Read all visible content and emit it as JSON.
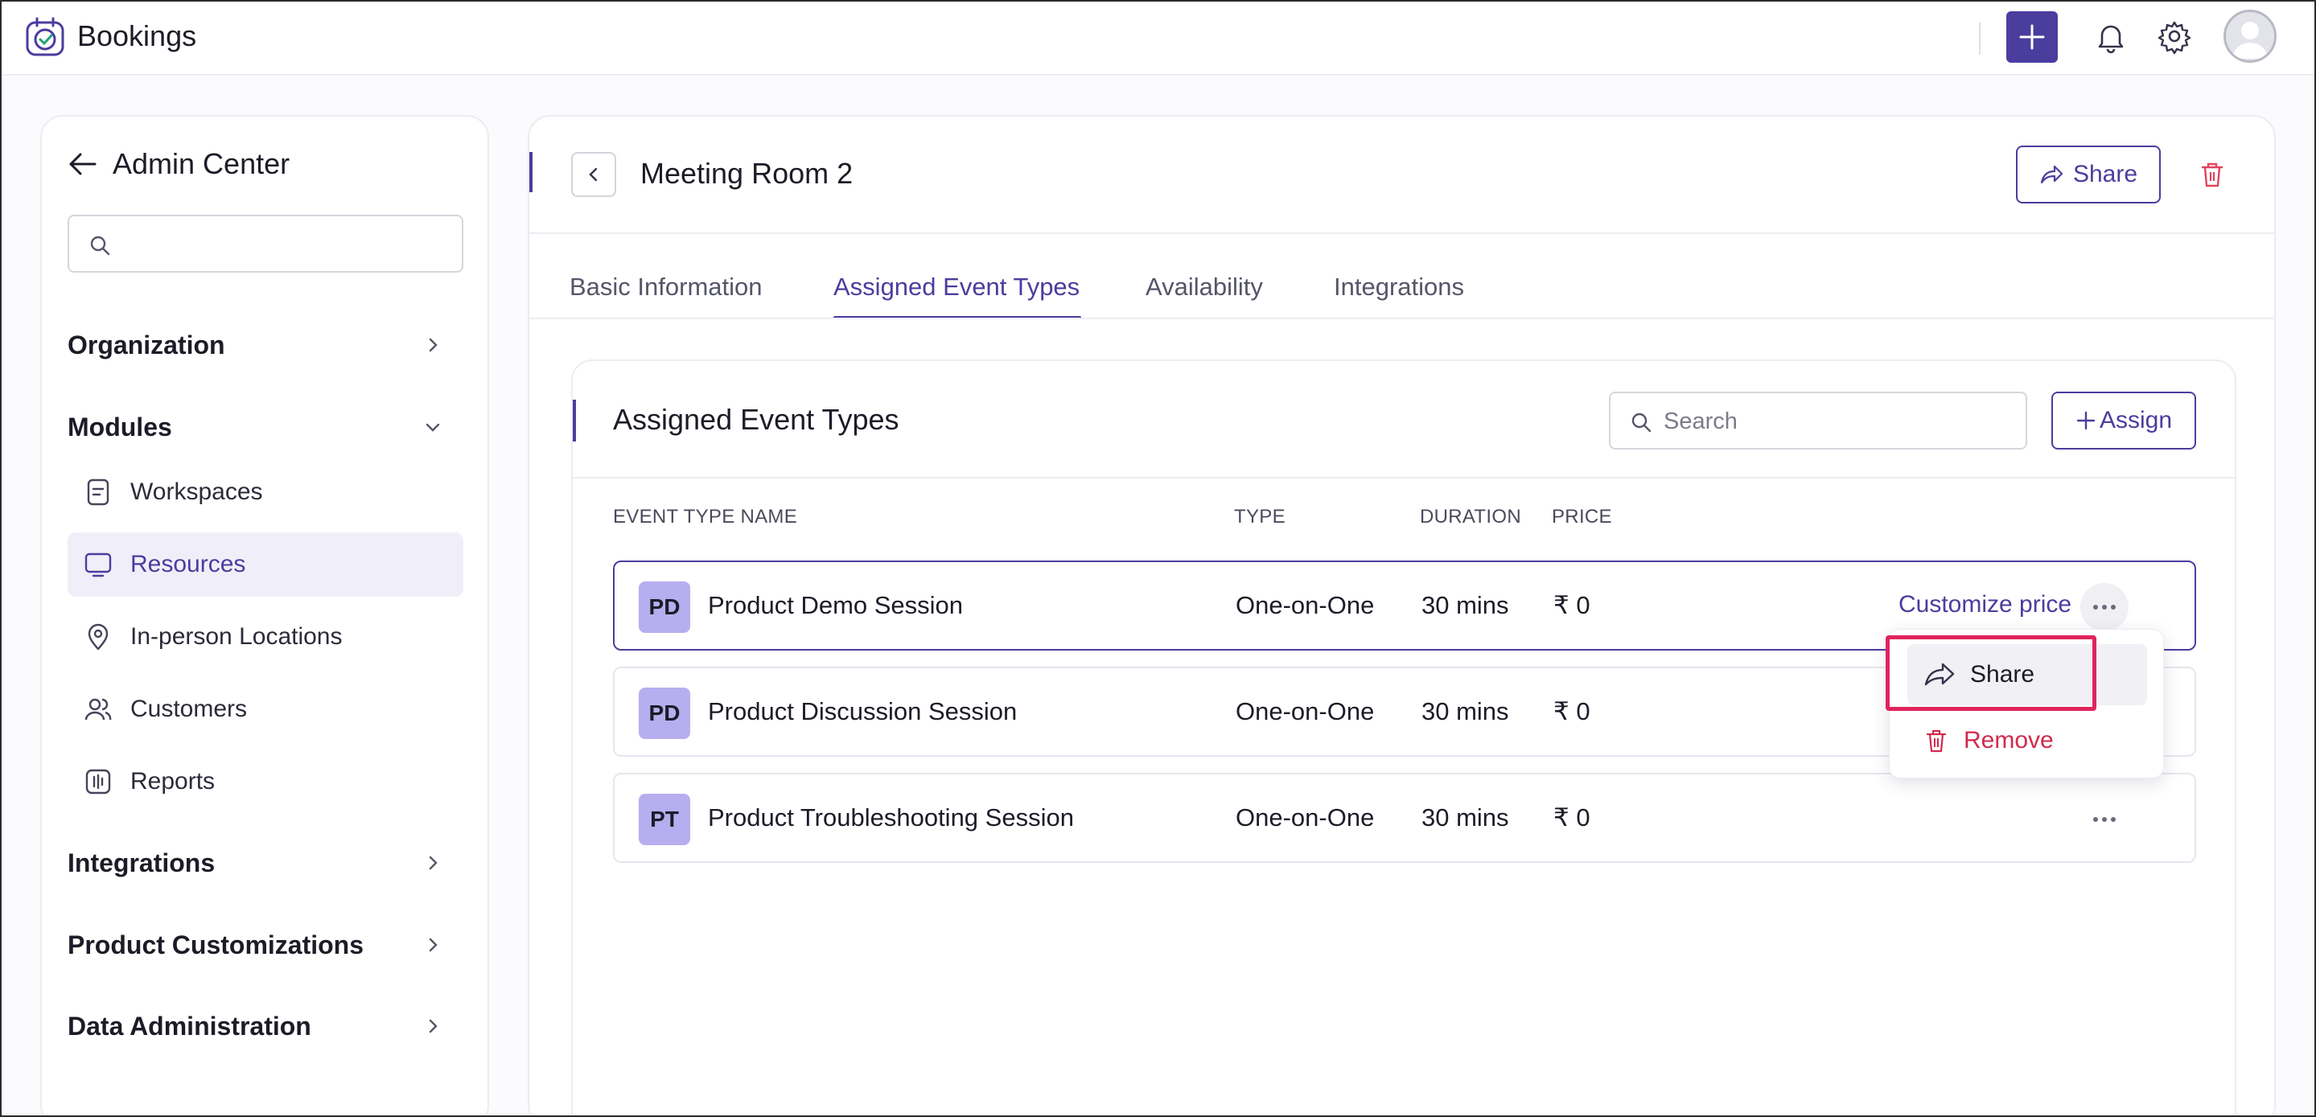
{
  "app": {
    "title": "Bookings"
  },
  "sidebar": {
    "back_label": "Admin Center",
    "search_placeholder": "",
    "sections": {
      "organization": "Organization",
      "modules": "Modules",
      "integrations": "Integrations",
      "product_customizations": "Product Customizations",
      "data_administration": "Data Administration"
    },
    "modules_items": [
      {
        "label": "Workspaces",
        "icon": "workspace-icon"
      },
      {
        "label": "Resources",
        "icon": "monitor-icon",
        "active": true
      },
      {
        "label": "In-person Locations",
        "icon": "location-pin-icon"
      },
      {
        "label": "Customers",
        "icon": "users-icon"
      },
      {
        "label": "Reports",
        "icon": "reports-icon"
      }
    ]
  },
  "header": {
    "title": "Meeting Room 2",
    "share_label": "Share"
  },
  "tabs": [
    {
      "label": "Basic Information"
    },
    {
      "label": "Assigned Event Types",
      "active": true
    },
    {
      "label": "Availability"
    },
    {
      "label": "Integrations"
    }
  ],
  "section": {
    "title": "Assigned Event Types",
    "search_placeholder": "Search",
    "assign_label": "Assign"
  },
  "table": {
    "columns": [
      "EVENT TYPE NAME",
      "TYPE",
      "DURATION",
      "PRICE"
    ],
    "rows": [
      {
        "initials": "PD",
        "name": "Product Demo Session",
        "type": "One-on-One",
        "duration": "30 mins",
        "price": "₹ 0",
        "action": "Customize price"
      },
      {
        "initials": "PD",
        "name": "Product Discussion Session",
        "type": "One-on-One",
        "duration": "30 mins",
        "price": "₹ 0"
      },
      {
        "initials": "PT",
        "name": "Product Troubleshooting Session",
        "type": "One-on-One",
        "duration": "30 mins",
        "price": "₹ 0"
      }
    ]
  },
  "menu": {
    "share": "Share",
    "remove": "Remove"
  },
  "colors": {
    "accent": "#4b3d9e",
    "danger": "#d12a4c",
    "badge": "#b7aef0",
    "highlight": "#e0245e"
  }
}
